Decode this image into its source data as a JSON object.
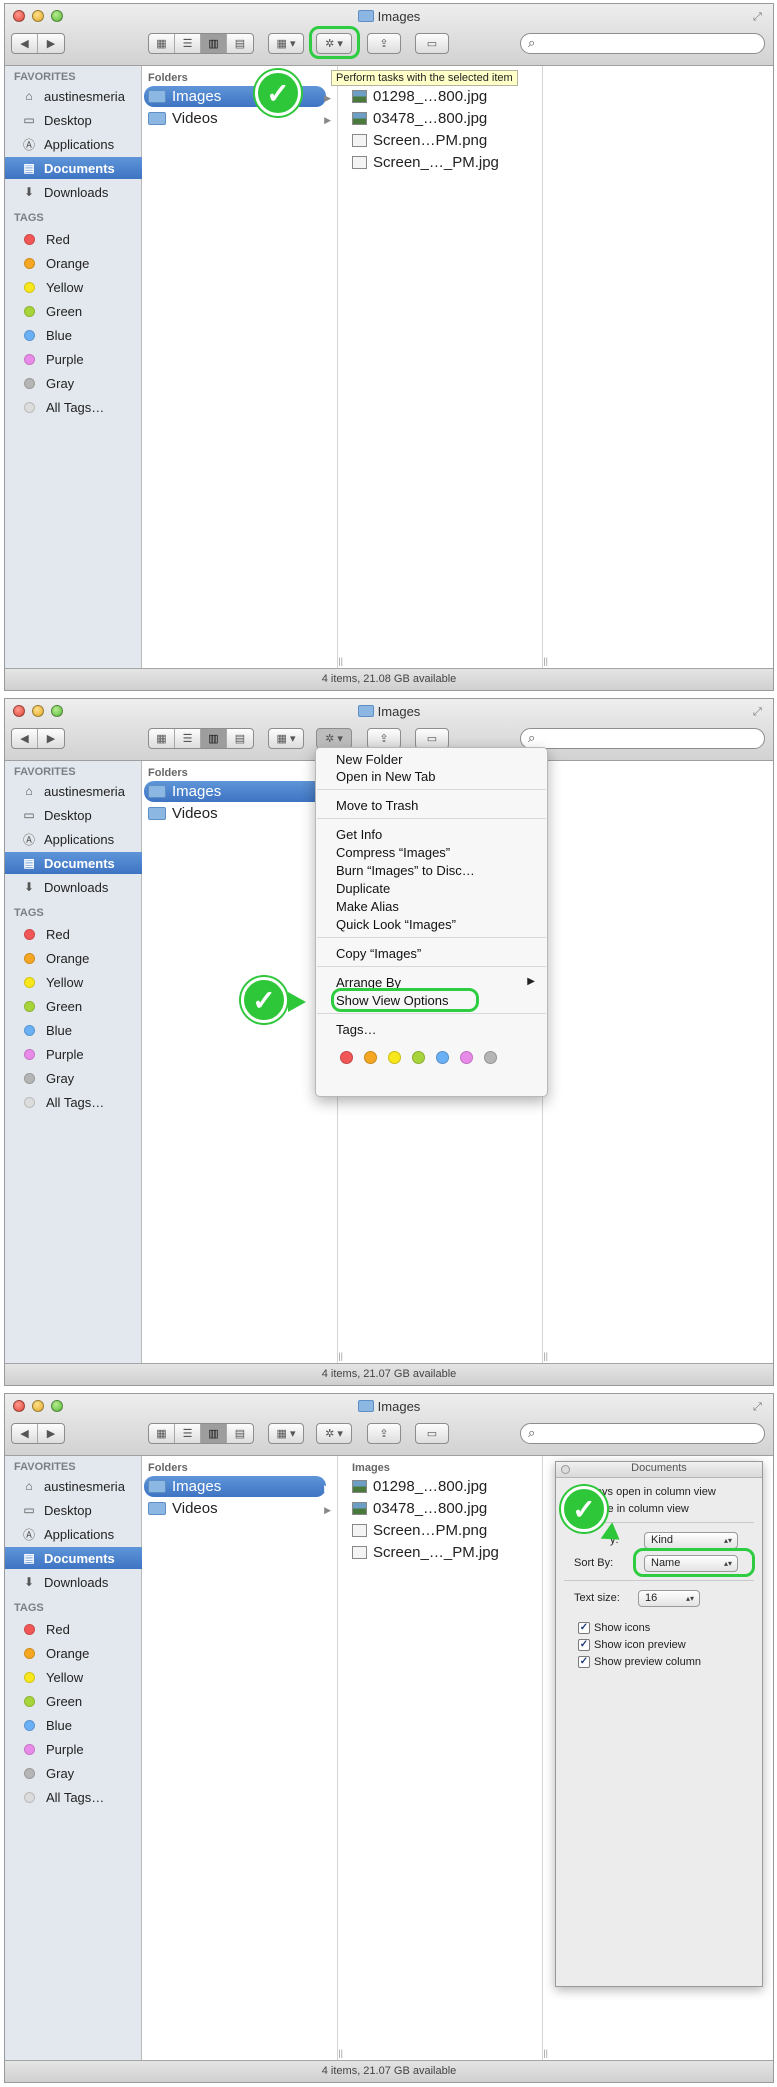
{
  "window_title": "Images",
  "sidebar": {
    "favorites_heading": "FAVORITES",
    "favorites": [
      {
        "label": "austinesmeria",
        "icon": "home-icon"
      },
      {
        "label": "Desktop",
        "icon": "desktop-icon"
      },
      {
        "label": "Applications",
        "icon": "applications-icon"
      },
      {
        "label": "Documents",
        "icon": "documents-icon"
      },
      {
        "label": "Downloads",
        "icon": "downloads-icon"
      }
    ],
    "tags_heading": "TAGS",
    "tags": [
      {
        "label": "Red",
        "color": "#f25757"
      },
      {
        "label": "Orange",
        "color": "#f5a623"
      },
      {
        "label": "Yellow",
        "color": "#f8e71c"
      },
      {
        "label": "Green",
        "color": "#a8d43b"
      },
      {
        "label": "Blue",
        "color": "#6ab0f5"
      },
      {
        "label": "Purple",
        "color": "#e88be8"
      },
      {
        "label": "Gray",
        "color": "#b5b5b5"
      },
      {
        "label": "All Tags…",
        "color": "#dcdcdc"
      }
    ]
  },
  "columns": {
    "folders_heading": "Folders",
    "folders": [
      "Images",
      "Videos"
    ],
    "images_heading": "Images",
    "files": [
      "01298_…800.jpg",
      "03478_…800.jpg",
      "Screen…PM.png",
      "Screen_…_PM.jpg"
    ]
  },
  "panels": [
    {
      "status": "4 items, 21.08 GB available"
    },
    {
      "status": "4 items, 21.07 GB available"
    },
    {
      "status": "4 items, 21.07 GB available"
    }
  ],
  "tooltip": "Perform tasks with the selected item",
  "action_menu": {
    "items": [
      "New Folder",
      "Open in New Tab",
      "Move to Trash",
      "Get Info",
      "Compress “Images”",
      "Burn “Images” to Disc…",
      "Duplicate",
      "Make Alias",
      "Quick Look “Images”",
      "Copy “Images”",
      "Arrange By",
      "Show View Options",
      "Tags…"
    ],
    "tag_colors": [
      "#f25757",
      "#f5a623",
      "#f8e71c",
      "#a8d43b",
      "#6ab0f5",
      "#e88be8",
      "#b5b5b5"
    ]
  },
  "view_options": {
    "title": "Documents",
    "always_open": "ways open in column view",
    "browse": "owse in column view",
    "arrange_label_partial": "y:",
    "arrange_value": "Kind",
    "sort_label": "Sort By:",
    "sort_value": "Name",
    "text_size_label": "Text size:",
    "text_size_value": "16",
    "checks": [
      "Show icons",
      "Show icon preview",
      "Show preview column"
    ]
  },
  "accent_green": "#2ecc40",
  "selection_blue": "#3e74c3"
}
